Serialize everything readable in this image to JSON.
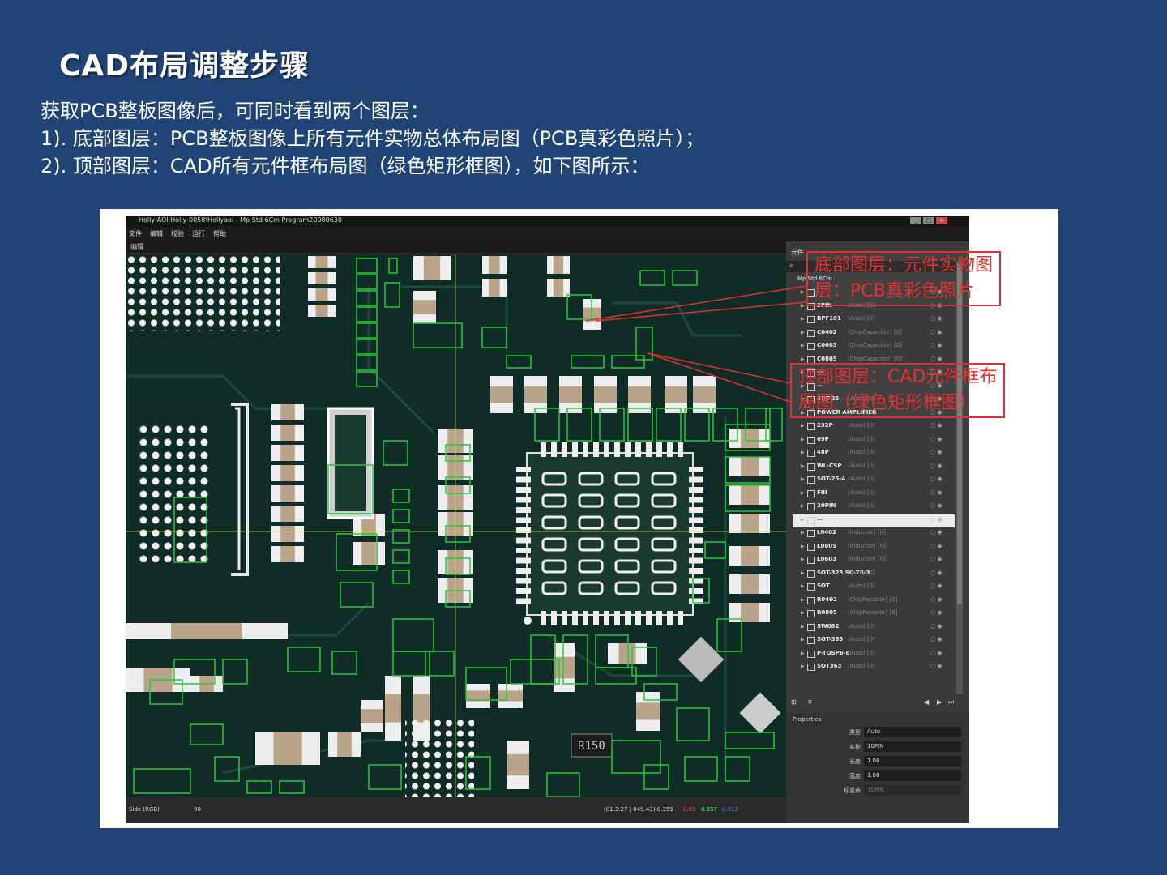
{
  "slide": {
    "title": "CAD布局调整步骤",
    "lines": [
      "获取PCB整板图像后，可同时看到两个图层：",
      "1). 底部图层：PCB整板图像上所有元件实物总体布局图（PCB真彩色照片）；",
      "2). 顶部图层：CAD所有元件框布局图（绿色矩形框图），如下图所示："
    ]
  },
  "app": {
    "title": "Holly AOI Holly-0058\\Hollyaoi - Mp Std 6Cm Program20080630",
    "window_buttons": [
      "_",
      "□",
      "×"
    ],
    "menu": [
      "文件",
      "编辑",
      "校验",
      "运行",
      "帮助"
    ],
    "toolbar_label": "编辑",
    "panel_header": "元件",
    "tree_root": "Mp Std 6Cm",
    "components": [
      {
        "name": "—",
        "sub": ""
      },
      {
        "name": "3PIN",
        "sub": "(Auto) [0]"
      },
      {
        "name": "BPF101",
        "sub": "(Auto) [0]"
      },
      {
        "name": "C0402",
        "sub": "(ChipCapacitor) [0]"
      },
      {
        "name": "C0603",
        "sub": "(ChipCapacitor) [0]"
      },
      {
        "name": "C0805",
        "sub": "(ChipCapacitor) [0]"
      },
      {
        "name": "—",
        "sub": ""
      },
      {
        "name": "—",
        "sub": ""
      },
      {
        "name": "SOT-25",
        "sub": "(Auto) [0]"
      },
      {
        "name": "POWER AMPLIFIER",
        "sub": "(Auto) [0]"
      },
      {
        "name": "232P",
        "sub": "(Auto) [0]"
      },
      {
        "name": "69P",
        "sub": "(Auto) [0]"
      },
      {
        "name": "48P",
        "sub": "(Auto) [0]"
      },
      {
        "name": "WL-CSP",
        "sub": "(Auto) [0]"
      },
      {
        "name": "SOT-25-4",
        "sub": "(Auto) [0]"
      },
      {
        "name": "FIII",
        "sub": "(Auto) [0]"
      },
      {
        "name": "20PIN",
        "sub": "(Auto) [0]"
      },
      {
        "name": "—",
        "sub": "",
        "selected": true
      },
      {
        "name": "L0402",
        "sub": "(Inductor) [0]"
      },
      {
        "name": "L0805",
        "sub": "(Inductor) [0]"
      },
      {
        "name": "L0603",
        "sub": "(Inductor) [0]"
      },
      {
        "name": "SOT-323 SC-70-3",
        "sub": "(Auto) [0]"
      },
      {
        "name": "SOT",
        "sub": "(Auto) [0]"
      },
      {
        "name": "R0402",
        "sub": "(ChipResistor) [0]"
      },
      {
        "name": "R0805",
        "sub": "(ChipResistor) [0]"
      },
      {
        "name": "SW082",
        "sub": "(Auto) [0]"
      },
      {
        "name": "SOT-363",
        "sub": "(Auto) [0]"
      },
      {
        "name": "P-TOSP6-6",
        "sub": "(Auto) [0]"
      },
      {
        "name": "SOT363",
        "sub": "(Auto) [0]"
      }
    ],
    "properties": {
      "header": "Properties",
      "rows": [
        {
          "label": "类型",
          "value": "Auto"
        },
        {
          "label": "名称",
          "value": "10PIN"
        },
        {
          "label": "长度",
          "value": "1.00"
        },
        {
          "label": "宽度",
          "value": "1.00"
        },
        {
          "label": "标准命",
          "value": "10PIN"
        }
      ]
    },
    "status": {
      "side": "Side (RGB)",
      "zoom": "90",
      "coords": "(01.3.27 | 049.43) 0.359",
      "r": "0.03",
      "g": "0.357",
      "b": "0.512"
    },
    "pcb_marking": "R150"
  },
  "callouts": {
    "bottom_layer": [
      "底部图层：元件实物图",
      "层：PCB真彩色照片"
    ],
    "top_layer": [
      "顶部图层：CAD元件框布",
      "局图（绿色矩形框图）"
    ]
  },
  "colors": {
    "background": "#204476",
    "cad_box": "#28c83c",
    "callout": "#e03030",
    "pcb": "#10302a"
  }
}
